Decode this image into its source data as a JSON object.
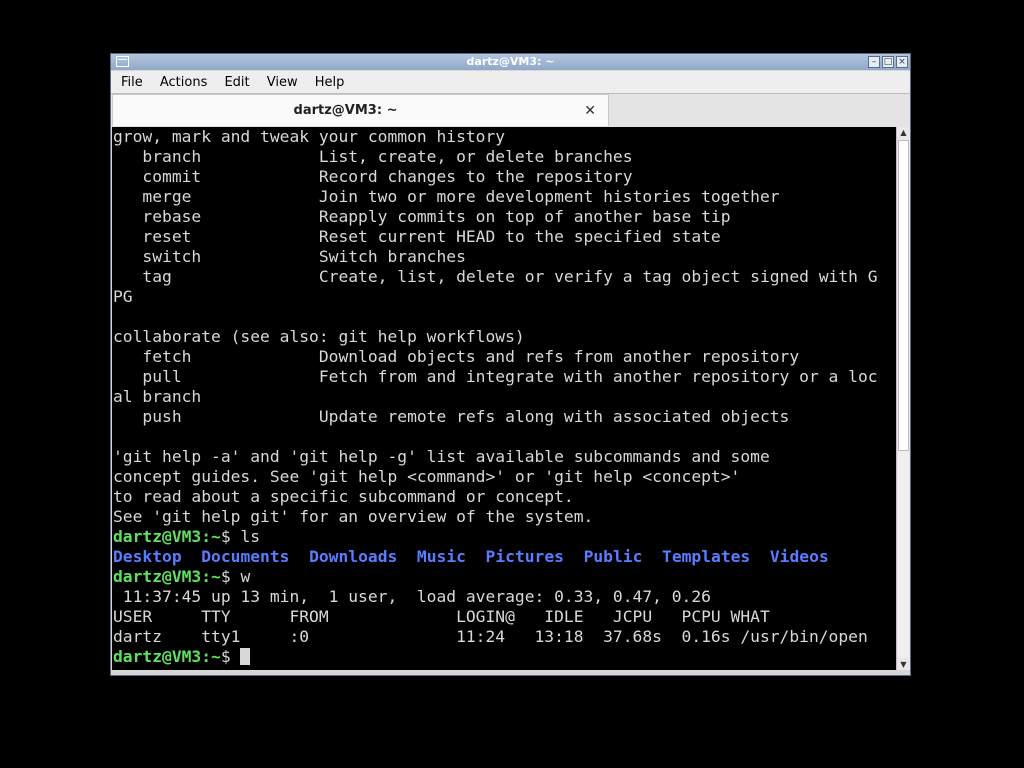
{
  "window": {
    "title": "dartz@VM3: ~",
    "controls": {
      "minimize": "–",
      "maximize": "□",
      "close": "×"
    }
  },
  "menu": [
    "File",
    "Actions",
    "Edit",
    "View",
    "Help"
  ],
  "tab": {
    "title": "dartz@VM3: ~",
    "close_icon": "close-tab-icon"
  },
  "prompt": {
    "user_host": "dartz@VM3",
    "path": ":~",
    "symbol": "$"
  },
  "terminal_lines": [
    "grow, mark and tweak your common history",
    "   branch            List, create, or delete branches",
    "   commit            Record changes to the repository",
    "   merge             Join two or more development histories together",
    "   rebase            Reapply commits on top of another base tip",
    "   reset             Reset current HEAD to the specified state",
    "   switch            Switch branches",
    "   tag               Create, list, delete or verify a tag object signed with G",
    "PG",
    "",
    "collaborate (see also: git help workflows)",
    "   fetch             Download objects and refs from another repository",
    "   pull              Fetch from and integrate with another repository or a loc",
    "al branch",
    "   push              Update remote refs along with associated objects",
    "",
    "'git help -a' and 'git help -g' list available subcommands and some",
    "concept guides. See 'git help <command>' or 'git help <concept>'",
    "to read about a specific subcommand or concept.",
    "See 'git help git' for an overview of the system."
  ],
  "commands": {
    "ls": " ls",
    "w": " w"
  },
  "ls_output": [
    "Desktop",
    "Documents",
    "Downloads",
    "Music",
    "Pictures",
    "Public",
    "Templates",
    "Videos"
  ],
  "w_output": [
    " 11:37:45 up 13 min,  1 user,  load average: 0.33, 0.47, 0.26",
    "USER     TTY      FROM             LOGIN@   IDLE   JCPU   PCPU WHAT",
    "dartz    tty1     :0               11:24   13:18  37.68s  0.16s /usr/bin/open"
  ],
  "scrollbar": {
    "position": 0.0,
    "visible_fraction": 0.6
  },
  "colors": {
    "prompt": "#5fe05f",
    "directory": "#5a7cff",
    "text": "#d8d8d8",
    "background": "#000000"
  }
}
